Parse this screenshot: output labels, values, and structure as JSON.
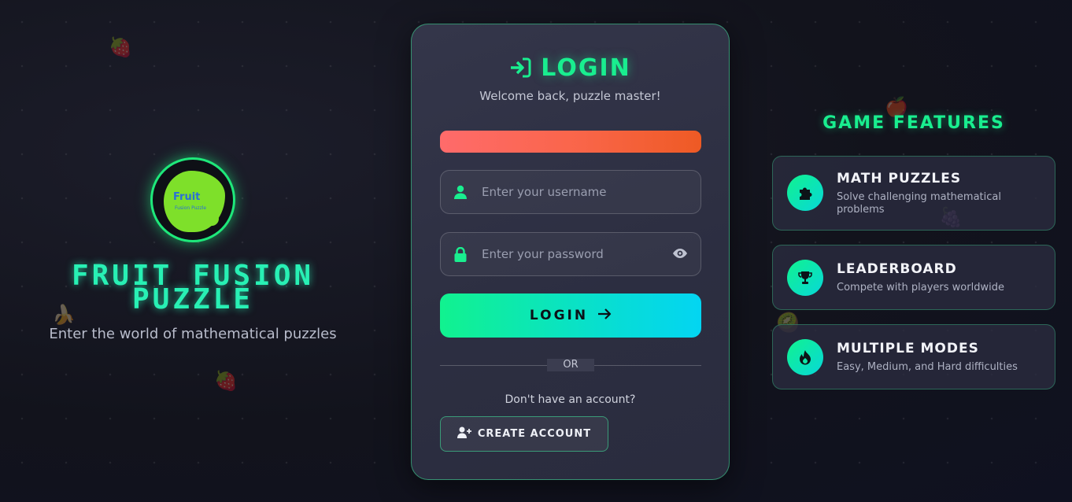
{
  "brand": {
    "logo_text": "Fruit",
    "logo_subtext": "Fusion Puzzle",
    "title_line1": "FRUIT FUSION",
    "title_line2": "PUZZLE",
    "tagline": "Enter the world of mathematical puzzles"
  },
  "login": {
    "title": "LOGIN",
    "title_icon": "sign-in-icon",
    "subtitle": "Welcome back, puzzle master!",
    "username": {
      "value": "",
      "placeholder": "Enter your username",
      "icon": "user-icon"
    },
    "password": {
      "value": "",
      "placeholder": "Enter your password",
      "icon": "lock-icon",
      "toggle_icon": "eye-icon"
    },
    "submit_label": "LOGIN",
    "submit_icon": "arrow-right-icon",
    "or_label": "OR",
    "no_account_text": "Don't have an account?",
    "create_label": "CREATE ACCOUNT",
    "create_icon": "user-plus-icon"
  },
  "features": {
    "title": "GAME FEATURES",
    "items": [
      {
        "name": "MATH PUZZLES",
        "desc": "Solve challenging mathematical problems",
        "icon": "puzzle-piece-icon"
      },
      {
        "name": "LEADERBOARD",
        "desc": "Compete with players worldwide",
        "icon": "trophy-icon"
      },
      {
        "name": "MULTIPLE MODES",
        "desc": "Easy, Medium, and Hard difficulties",
        "icon": "fire-icon"
      }
    ]
  },
  "colors": {
    "accent": "#19ee8f",
    "accent_cyan": "#03d5f2",
    "strength_bar": "#ee5a24",
    "background": "#12131c",
    "card": "#2f3144"
  }
}
